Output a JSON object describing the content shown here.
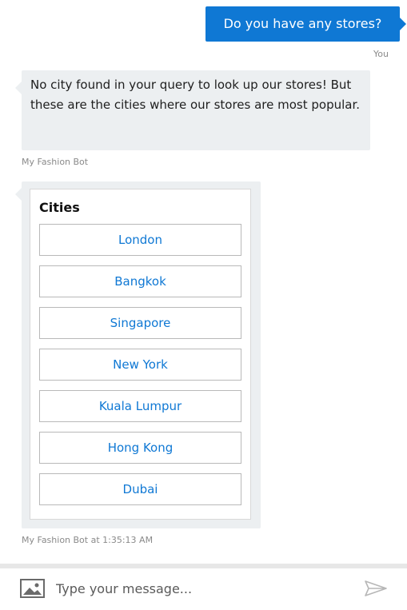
{
  "conversation": {
    "user_message": "Do you have any stores?",
    "user_sender": "You",
    "bot_message": "No city found in your query to look up our stores! But these are the cities where our stores are most popular.",
    "bot_sender": "My Fashion Bot",
    "card": {
      "title": "Cities",
      "buttons": [
        "London",
        "Bangkok",
        "Singapore",
        "New York",
        "Kuala Lumpur",
        "Hong Kong",
        "Dubai"
      ]
    },
    "card_timestamp": "My Fashion Bot at 1:35:13 AM"
  },
  "input": {
    "placeholder": "Type your message...",
    "value": "",
    "left_icon": "image-icon",
    "send_icon": "send-icon"
  },
  "colors": {
    "accent": "#0f78d4",
    "bubble_bg": "#eceff1"
  }
}
